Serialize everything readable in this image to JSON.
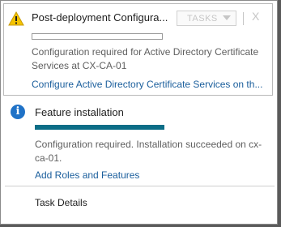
{
  "notifications": [
    {
      "title": "Post-deployment Configura...",
      "status_icon": "warning-icon",
      "tasks_label": "TASKS",
      "close_label": "X",
      "progress": 0,
      "description": "Configuration required for Active Directory Certificate Services at CX-CA-01",
      "link": "Configure Active Directory Certificate Services on th..."
    },
    {
      "title": "Feature installation",
      "status_icon": "info-icon",
      "progress": 100,
      "description": "Configuration required. Installation succeeded on cx-ca-01.",
      "link": "Add Roles and Features"
    }
  ],
  "footer": {
    "task_details": "Task Details"
  },
  "colors": {
    "warning": "#f5c400",
    "info": "#1f72c7",
    "progress_fill": "#0c6e87",
    "link": "#1a5e9c"
  }
}
